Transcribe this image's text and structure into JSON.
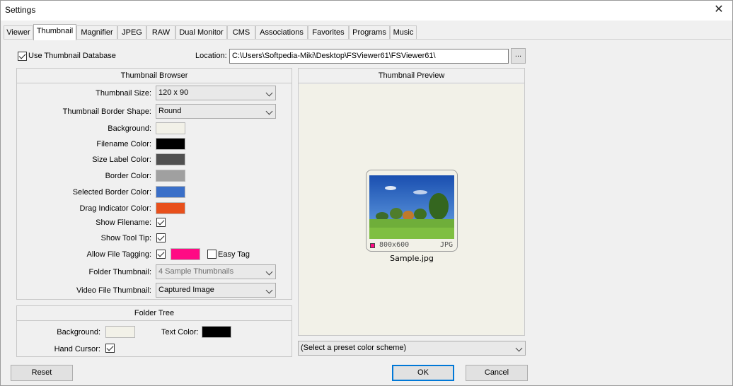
{
  "window": {
    "title": "Settings"
  },
  "tabs": [
    {
      "label": "Viewer"
    },
    {
      "label": "Thumbnail"
    },
    {
      "label": "Magnifier"
    },
    {
      "label": "JPEG"
    },
    {
      "label": "RAW"
    },
    {
      "label": "Dual Monitor"
    },
    {
      "label": "CMS"
    },
    {
      "label": "Associations"
    },
    {
      "label": "Favorites"
    },
    {
      "label": "Programs"
    },
    {
      "label": "Music"
    }
  ],
  "db": {
    "use_db_label": "Use Thumbnail Database",
    "location_label": "Location:",
    "location_value": "C:\\Users\\Softpedia-Miki\\Desktop\\FSViewer61\\FSViewer61\\",
    "browse_label": "..."
  },
  "browser": {
    "title": "Thumbnail Browser",
    "size_label": "Thumbnail Size:",
    "size_value": "120 x 90",
    "border_shape_label": "Thumbnail Border Shape:",
    "border_shape_value": "Round",
    "background_label": "Background:",
    "filename_color_label": "Filename Color:",
    "size_label_color_label": "Size Label Color:",
    "border_color_label": "Border Color:",
    "selected_border_label": "Selected Border Color:",
    "drag_indicator_label": "Drag Indicator Color:",
    "show_filename_label": "Show Filename:",
    "show_tooltip_label": "Show Tool Tip:",
    "file_tagging_label": "Allow File Tagging:",
    "easy_tag_label": "Easy Tag",
    "folder_thumb_label": "Folder Thumbnail:",
    "folder_thumb_value": "4 Sample Thumbnails",
    "video_thumb_label": "Video File Thumbnail:",
    "video_thumb_value": "Captured Image",
    "colors": {
      "background": "#f2f1e8",
      "filename": "#000000",
      "size_label": "#505050",
      "border": "#a0a0a0",
      "selected_border": "#3a6fc8",
      "drag_indicator": "#e8501c",
      "tag": "#ff0a84"
    }
  },
  "folder_tree": {
    "title": "Folder Tree",
    "background_label": "Background:",
    "text_color_label": "Text Color:",
    "hand_cursor_label": "Hand Cursor:",
    "colors": {
      "background": "#f2f1e8",
      "text": "#000000"
    }
  },
  "preview": {
    "title": "Thumbnail Preview",
    "dims": "800x600",
    "ext": "JPG",
    "filename": "Sample.jpg",
    "preset_value": "(Select a preset color scheme)"
  },
  "buttons": {
    "reset": "Reset",
    "ok": "OK",
    "cancel": "Cancel"
  }
}
